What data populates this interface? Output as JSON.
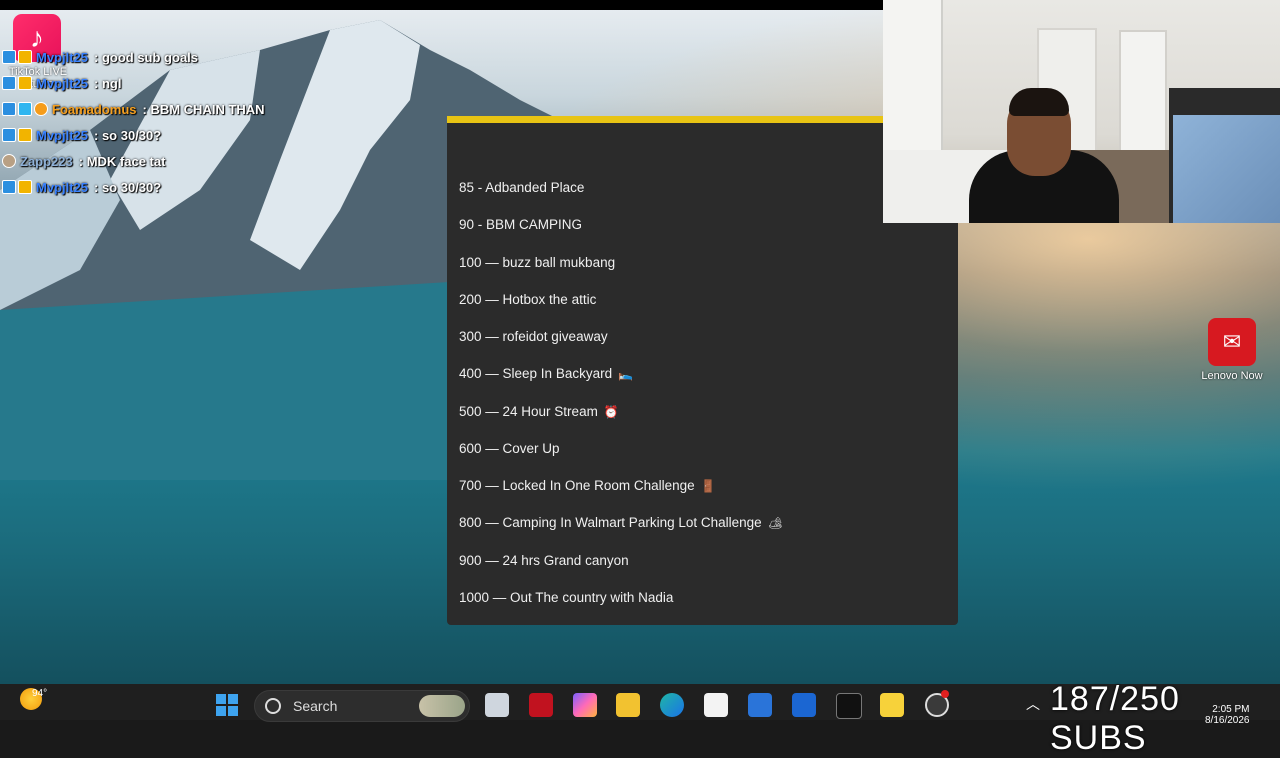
{
  "chat": [
    {
      "user": "Mvpjlt25",
      "message": ": good sub goals",
      "user_color": "blue"
    },
    {
      "user": "Mvpjlt25",
      "message": ": ngl",
      "user_color": "blue"
    },
    {
      "user": "Foamadomus",
      "message": ": BBM CHAIN THAN",
      "user_color": "orange"
    },
    {
      "user": "Mvpjlt25",
      "message": ": so 30/30?",
      "user_color": "blue"
    },
    {
      "user": "Zapp223",
      "message": ": MDK face tat",
      "user_color": "gray"
    },
    {
      "user": "Mvpjlt25",
      "message": ": so 30/30?",
      "user_color": "blue"
    }
  ],
  "tiktok": {
    "label": "TikTok LIVE Studio"
  },
  "goals": [
    {
      "text": "85 -  Adbanded Place",
      "emoji": ""
    },
    {
      "text": "90 - BBM CAMPING",
      "emoji": ""
    },
    {
      "text": "100 — buzz ball mukbang",
      "emoji": ""
    },
    {
      "text": "200 — Hotbox the attic",
      "emoji": ""
    },
    {
      "text": "300 — rofeidot giveaway",
      "emoji": ""
    },
    {
      "text": "400 — Sleep In Backyard",
      "emoji": "🛌"
    },
    {
      "text": "500 — 24 Hour Stream",
      "emoji": "⏰"
    },
    {
      "text": "600 — Cover Up",
      "emoji": ""
    },
    {
      "text": "700 — Locked In One Room Challenge",
      "emoji": "🚪"
    },
    {
      "text": "800 — Camping In Walmart Parking Lot Challenge",
      "emoji": "🏕"
    },
    {
      "text": "900 — 24 hrs Grand canyon",
      "emoji": ""
    },
    {
      "text": "1000 — Out The country with Nadia",
      "emoji": ""
    }
  ],
  "desktop": {
    "lenovo_label": "Lenovo Now"
  },
  "taskbar": {
    "weather_temp": "94°",
    "search_placeholder": "Search",
    "subs_counter": "187/250 SUBS",
    "date": "8/16/2026",
    "time": "2:05 PM"
  },
  "colors": {
    "accent_yellow": "#e8c414",
    "panel_bg": "#2b2b2b",
    "tiktok": "#e8125a",
    "lenovo": "#d71920"
  }
}
